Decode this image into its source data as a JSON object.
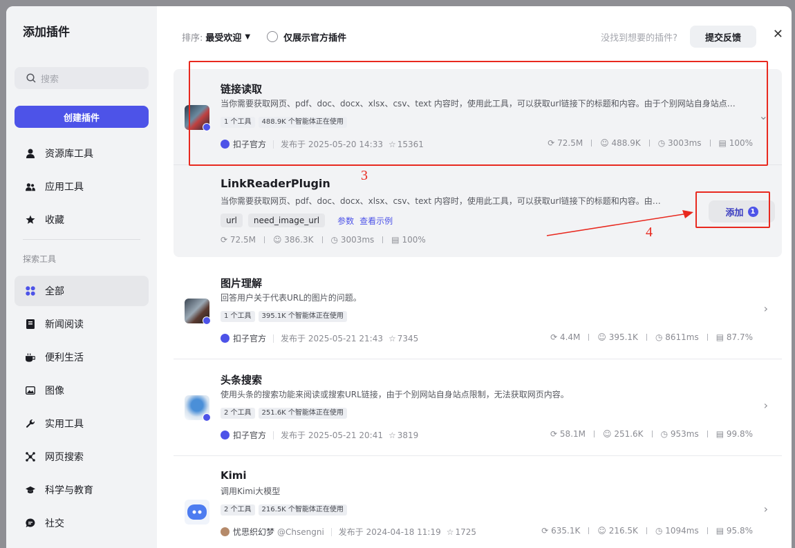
{
  "sidebar": {
    "title": "添加插件",
    "search_placeholder": "搜索",
    "create_label": "创建插件",
    "items": [
      {
        "label": "资源库工具"
      },
      {
        "label": "应用工具"
      },
      {
        "label": "收藏"
      }
    ],
    "explore_label": "探索工具",
    "categories": [
      {
        "label": "全部"
      },
      {
        "label": "新闻阅读"
      },
      {
        "label": "便利生活"
      },
      {
        "label": "图像"
      },
      {
        "label": "实用工具"
      },
      {
        "label": "网页搜索"
      },
      {
        "label": "科学与教育"
      },
      {
        "label": "社交"
      }
    ]
  },
  "toolbar": {
    "sort_label": "排序:",
    "sort_value": "最受欢迎",
    "official_only": "仅展示官方插件",
    "not_found": "没找到想要的插件?",
    "feedback": "提交反馈"
  },
  "plugins": [
    {
      "name": "链接读取",
      "desc": "当你需要获取网页、pdf、doc、docx、xlsx、csv、text 内容时，使用此工具，可以获取url链接下的标题和内容。由于个别网站自身站点…",
      "tags": [
        "1 个工具",
        "488.9K 个智能体正在使用"
      ],
      "author": "扣子官方",
      "published": "发布于 2025-05-20 14:33",
      "favorites": "15361",
      "stats": [
        "72.5M",
        "488.9K",
        "3003ms",
        "100%"
      ]
    },
    {
      "name": "图片理解",
      "desc": "回答用户关于代表URL的图片的问题。",
      "tags": [
        "1 个工具",
        "395.1K 个智能体正在使用"
      ],
      "author": "扣子官方",
      "published": "发布于 2025-05-21 21:43",
      "favorites": "7345",
      "stats": [
        "4.4M",
        "395.1K",
        "8611ms",
        "87.7%"
      ]
    },
    {
      "name": "头条搜索",
      "desc": "使用头条的搜索功能来阅读或搜索URL链接，由于个别网站自身站点限制，无法获取网页内容。",
      "tags": [
        "2 个工具",
        "251.6K 个智能体正在使用"
      ],
      "author": "扣子官方",
      "published": "发布于 2025-05-21 20:41",
      "favorites": "3819",
      "stats": [
        "58.1M",
        "251.6K",
        "953ms",
        "99.8%"
      ]
    },
    {
      "name": "Kimi",
      "desc": "调用Kimi大模型",
      "tags": [
        "2 个工具",
        "216.5K 个智能体正在使用"
      ],
      "author": "忧思织幻梦",
      "handle": "@Chsengni",
      "published": "发布于 2024-04-18 11:19",
      "favorites": "1725",
      "stats": [
        "635.1K",
        "216.5K",
        "1094ms",
        "95.8%"
      ]
    }
  ],
  "tool": {
    "name": "LinkReaderPlugin",
    "desc": "当你需要获取网页、pdf、doc、docx、xlsx、csv、text 内容时，使用此工具，可以获取url链接下的标题和内容。由于…",
    "params": [
      "url",
      "need_image_url"
    ],
    "params_link": "参数",
    "example_link": "查看示例",
    "stats": [
      "72.5M",
      "386.3K",
      "3003ms",
      "100%"
    ],
    "add_label": "添加",
    "add_count": "1"
  },
  "annotations": {
    "box3": "3",
    "box4": "4"
  },
  "colors": {
    "accent": "#4d53e8",
    "annotation": "#e8281e"
  }
}
